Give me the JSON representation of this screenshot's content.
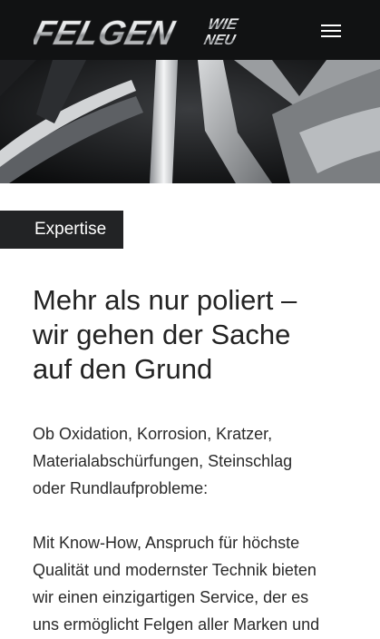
{
  "header": {
    "logo_main": "FELGEN",
    "logo_sub_top": "WIE",
    "logo_sub_bottom": "NEU",
    "menu_icon": "hamburger-icon"
  },
  "hero": {
    "image": "wheel-rim-closeup"
  },
  "section": {
    "tag": "Expertise",
    "title_lines": [
      "Mehr als nur poliert –",
      "wir gehen der Sache",
      "auf den Grund"
    ],
    "para1_lines": [
      "Ob Oxidation, Korrosion, Kratzer,",
      "Materialabschürfungen, Steinschlag",
      "oder Rundlaufprobleme:"
    ],
    "para2_lines": [
      "Mit Know-How, Anspruch für höchste",
      "Qualität und modernster Technik bieten",
      "wir einen einzigartigen Service, der es",
      "uns ermöglicht Felgen aller Marken und"
    ]
  },
  "colors": {
    "header_bg": "#111213",
    "tag_bg": "#222325",
    "text": "#232323"
  }
}
